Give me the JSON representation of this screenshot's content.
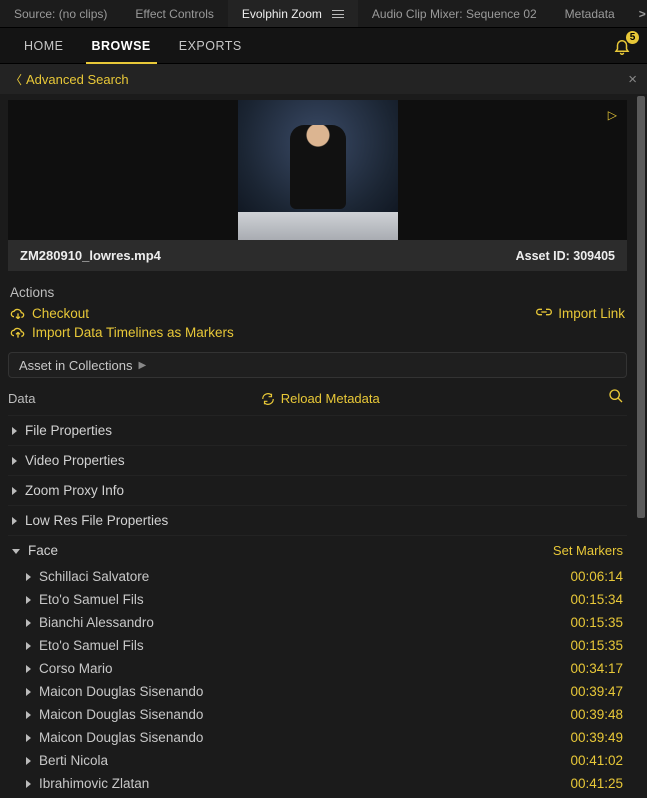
{
  "panel_tabs": {
    "items": [
      {
        "label": "Source: (no clips)"
      },
      {
        "label": "Effect Controls"
      },
      {
        "label": "Evolphin Zoom",
        "active": true
      },
      {
        "label": "Audio Clip Mixer: Sequence 02"
      },
      {
        "label": "Metadata"
      }
    ],
    "overflow": ">>"
  },
  "nav": {
    "items": [
      {
        "label": "HOME"
      },
      {
        "label": "BROWSE",
        "active": true
      },
      {
        "label": "EXPORTS"
      }
    ],
    "bell_badge": "5"
  },
  "adv_search": {
    "label": "Advanced Search",
    "close": "×"
  },
  "preview": {
    "filename": "ZM280910_lowres.mp4",
    "asset_id_label": "Asset ID: 309405"
  },
  "actions": {
    "title": "Actions",
    "checkout": "Checkout",
    "import_markers": "Import Data Timelines as Markers",
    "import_link": "Import Link"
  },
  "collections": {
    "label": "Asset in Collections"
  },
  "data_header": {
    "label": "Data",
    "reload": "Reload Metadata"
  },
  "groups": [
    {
      "label": "File Properties"
    },
    {
      "label": "Video Properties"
    },
    {
      "label": "Zoom Proxy Info"
    },
    {
      "label": "Low Res File Properties"
    }
  ],
  "face_group": {
    "label": "Face",
    "set_markers": "Set Markers",
    "items": [
      {
        "name": "Schillaci Salvatore",
        "ts": "00:06:14"
      },
      {
        "name": "Eto'o Samuel Fils",
        "ts": "00:15:34"
      },
      {
        "name": "Bianchi Alessandro",
        "ts": "00:15:35"
      },
      {
        "name": "Eto'o Samuel Fils",
        "ts": "00:15:35"
      },
      {
        "name": "Corso Mario",
        "ts": "00:34:17"
      },
      {
        "name": "Maicon Douglas Sisenando",
        "ts": "00:39:47"
      },
      {
        "name": "Maicon Douglas Sisenando",
        "ts": "00:39:48"
      },
      {
        "name": "Maicon Douglas Sisenando",
        "ts": "00:39:49"
      },
      {
        "name": "Berti Nicola",
        "ts": "00:41:02"
      },
      {
        "name": "Ibrahimovic Zlatan",
        "ts": "00:41:25"
      }
    ]
  }
}
